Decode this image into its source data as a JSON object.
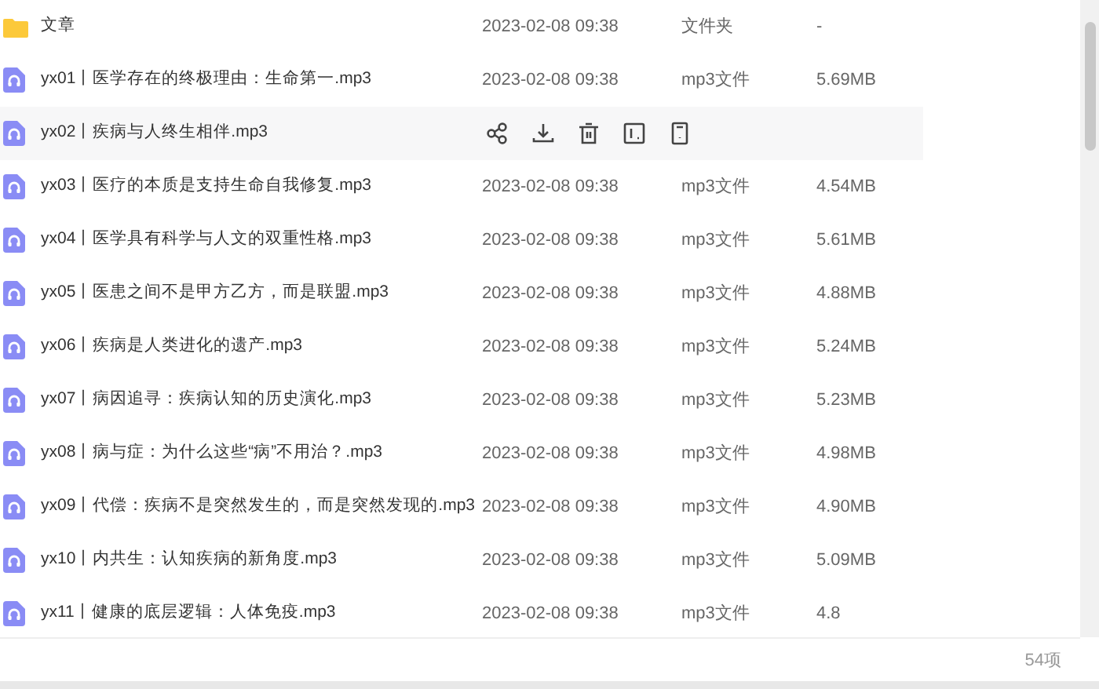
{
  "files": [
    {
      "kind": "folder",
      "name": "文章",
      "date": "2023-02-08 09:38",
      "type": "文件夹",
      "size": "-",
      "hovered": false
    },
    {
      "kind": "audio",
      "name": "yx01丨医学存在的终极理由：生命第一.mp3",
      "date": "2023-02-08 09:38",
      "type": "mp3文件",
      "size": "5.69MB",
      "hovered": false
    },
    {
      "kind": "audio",
      "name": "yx02丨疾病与人终生相伴.mp3",
      "hovered": true
    },
    {
      "kind": "audio",
      "name": "yx03丨医疗的本质是支持生命自我修复.mp3",
      "date": "2023-02-08 09:38",
      "type": "mp3文件",
      "size": "4.54MB",
      "hovered": false
    },
    {
      "kind": "audio",
      "name": "yx04丨医学具有科学与人文的双重性格.mp3",
      "date": "2023-02-08 09:38",
      "type": "mp3文件",
      "size": "5.61MB",
      "hovered": false
    },
    {
      "kind": "audio",
      "name": "yx05丨医患之间不是甲方乙方，而是联盟.mp3",
      "date": "2023-02-08 09:38",
      "type": "mp3文件",
      "size": "4.88MB",
      "hovered": false
    },
    {
      "kind": "audio",
      "name": "yx06丨疾病是人类进化的遗产.mp3",
      "date": "2023-02-08 09:38",
      "type": "mp3文件",
      "size": "5.24MB",
      "hovered": false
    },
    {
      "kind": "audio",
      "name": "yx07丨病因追寻：疾病认知的历史演化.mp3",
      "date": "2023-02-08 09:38",
      "type": "mp3文件",
      "size": "5.23MB",
      "hovered": false
    },
    {
      "kind": "audio",
      "name": "yx08丨病与症：为什么这些“病”不用治？.mp3",
      "date": "2023-02-08 09:38",
      "type": "mp3文件",
      "size": "4.98MB",
      "hovered": false
    },
    {
      "kind": "audio",
      "name": "yx09丨代偿：疾病不是突然发生的，而是突然发现的.mp3",
      "date": "2023-02-08 09:38",
      "type": "mp3文件",
      "size": "4.90MB",
      "hovered": false
    },
    {
      "kind": "audio",
      "name": "yx10丨内共生：认知疾病的新角度.mp3",
      "date": "2023-02-08 09:38",
      "type": "mp3文件",
      "size": "5.09MB",
      "hovered": false
    },
    {
      "kind": "audio",
      "name": "yx11丨健康的底层逻辑：人体免疫.mp3",
      "date": "2023-02-08 09:38",
      "type": "mp3文件",
      "size": "4.8",
      "hovered": false
    }
  ],
  "footer": {
    "count": "54项"
  }
}
